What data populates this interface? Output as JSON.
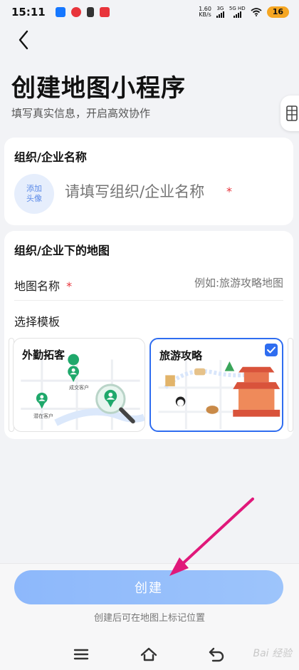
{
  "status_bar": {
    "time": "15:11",
    "net_speed_value": "1.60",
    "net_speed_unit": "KB/s",
    "sim1": "3G",
    "sim2": "5G HD",
    "battery": "16"
  },
  "header": {
    "title": "创建地图小程序",
    "subtitle": "填写真实信息，开启高效协作"
  },
  "org_card": {
    "title": "组织/企业名称",
    "avatar_line1": "添加",
    "avatar_line2": "头像",
    "input_placeholder": "请填写组织/企业名称",
    "required_mark": "*"
  },
  "map_card": {
    "title": "组织/企业下的地图",
    "map_name_label": "地图名称",
    "required_mark": "*",
    "map_name_placeholder": "例如:旅游攻略地图",
    "template_label": "选择模板",
    "templates": [
      {
        "name": "外勤拓客",
        "selected": false,
        "pin_labels": [
          "成交客户",
          "潜在客户"
        ]
      },
      {
        "name": "旅游攻略",
        "selected": true
      }
    ]
  },
  "footer": {
    "create_button": "创建",
    "hint": "创建后可在地图上标记位置"
  },
  "watermark": "Bai 经验",
  "colors": {
    "accent": "#2f6df0",
    "button": "#8db8fb",
    "required": "#e8343b",
    "arrow": "#e0187a",
    "pin_green": "#1fa86b"
  },
  "icons": [
    "back-arrow-icon",
    "grid-icon",
    "check-icon",
    "magnifier-icon",
    "menu-icon",
    "home-icon",
    "return-icon"
  ]
}
